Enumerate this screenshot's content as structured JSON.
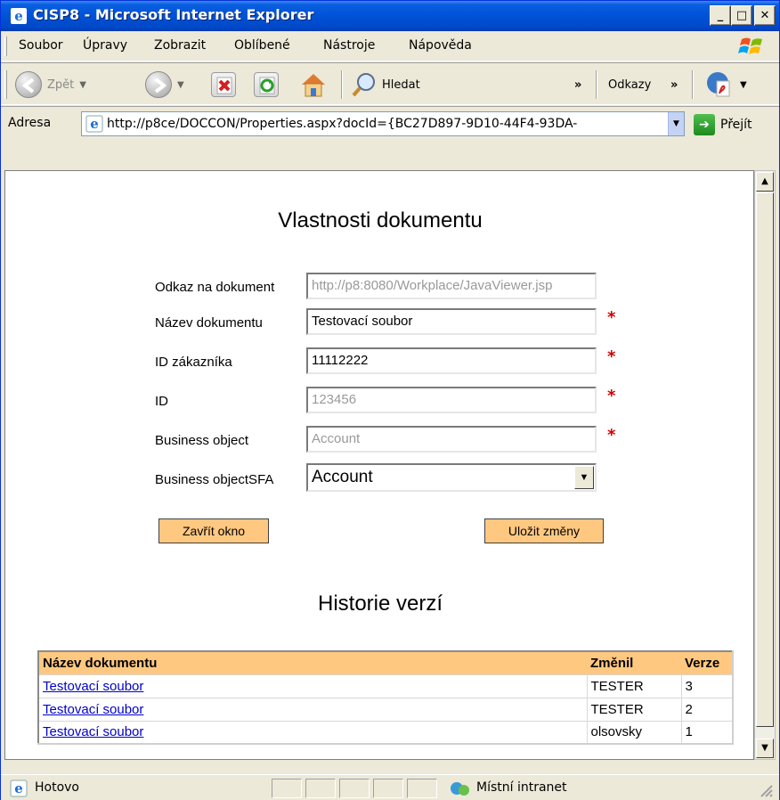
{
  "window": {
    "title": "CISP8 - Microsoft Internet Explorer",
    "min_label": "_",
    "max_label": "□",
    "close_label": "✕"
  },
  "menu": {
    "items": [
      "Soubor",
      "Úpravy",
      "Zobrazit",
      "Oblíbené",
      "Nástroje",
      "Nápověda"
    ]
  },
  "toolbar": {
    "back_label": "Zpět",
    "search_label": "Hledat",
    "links_label": "Odkazy",
    "overflow": "»"
  },
  "address": {
    "label": "Adresa",
    "url": "http://p8ce/DOCCON/Properties.aspx?docId={BC27D897-9D10-44F4-93DA-",
    "go_label": "Přejít"
  },
  "page": {
    "title": "Vlastnosti dokumentu",
    "fields": [
      {
        "label": "Odkaz na dokument",
        "value": "http://p8:8080/Workplace/JavaViewer.jsp",
        "readonly": true,
        "required": false
      },
      {
        "label": "Název dokumentu",
        "value": "Testovací soubor",
        "readonly": false,
        "required": true
      },
      {
        "label": "ID zákazníka",
        "value": "11112222",
        "readonly": false,
        "required": true
      },
      {
        "label": "ID",
        "value": "123456",
        "readonly": true,
        "required": true
      },
      {
        "label": "Business object",
        "value": "Account",
        "readonly": true,
        "required": true
      }
    ],
    "select": {
      "label": "Business objectSFA",
      "value": "Account"
    },
    "required_mark": "*",
    "close_button": "Zavřít okno",
    "save_button": "Uložit změny",
    "history_title": "Historie verzí",
    "history": {
      "headers": [
        "Název dokumentu",
        "Změnil",
        "Verze"
      ],
      "rows": [
        [
          "Testovací soubor",
          "TESTER",
          "3"
        ],
        [
          "Testovací soubor",
          "TESTER",
          "2"
        ],
        [
          "Testovací soubor",
          "olsovsky",
          "1"
        ]
      ]
    }
  },
  "status": {
    "text": "Hotovo",
    "zone": "Místní intranet"
  },
  "colors": {
    "accent_orange": "#ffc880",
    "link": "#0000cc",
    "required": "#cc0000",
    "titlebar": "#0052d6"
  }
}
